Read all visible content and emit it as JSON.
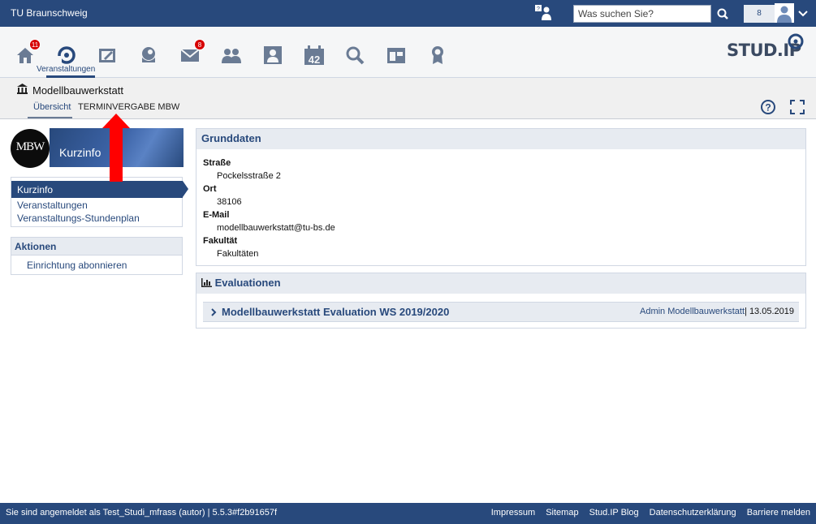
{
  "topbar": {
    "brand": "TU Braunschweig",
    "search_placeholder": "Was suchen Sie?",
    "notification_count": "8"
  },
  "iconnav": {
    "home_badge": "11",
    "messages_badge": "8",
    "active_label": "Veranstaltungen",
    "calendar_day": "42"
  },
  "logo_text": "STUD.IP",
  "context": {
    "title": "Modellbauwerkstatt",
    "tabs": [
      "Übersicht",
      "TERMINVERGABE MBW"
    ]
  },
  "sidebar": {
    "logo_text": "MBW",
    "banner": "Kurzinfo",
    "nav": [
      "Kurzinfo",
      "Veranstaltungen",
      "Veranstaltungs-Stundenplan"
    ],
    "actions_title": "Aktionen",
    "actions": [
      "Einrichtung abonnieren"
    ]
  },
  "grunddaten": {
    "title": "Grunddaten",
    "fields": [
      {
        "label": "Straße",
        "value": "Pockelsstraße 2"
      },
      {
        "label": "Ort",
        "value": "38106"
      },
      {
        "label": "E-Mail",
        "value": "modellbauwerkstatt@tu-bs.de"
      },
      {
        "label": "Fakultät",
        "value": "Fakultäten"
      }
    ]
  },
  "evaluationen": {
    "title": "Evaluationen",
    "item_title": "Modellbauwerkstatt Evaluation WS 2019/2020",
    "author": "Admin Modellbauwerkstatt",
    "separator": "|",
    "date": "13.05.2019"
  },
  "footer": {
    "status": "Sie sind angemeldet als Test_Studi_mfrass (autor) | 5.5.3#f2b91657f",
    "links": [
      "Impressum",
      "Sitemap",
      "Stud.IP Blog",
      "Datenschutzerklärung",
      "Barriere melden"
    ]
  },
  "colors": {
    "primary": "#28497c",
    "panel_head": "#e7ebf1",
    "badge": "#d60000",
    "annotation": "#ff0000"
  }
}
